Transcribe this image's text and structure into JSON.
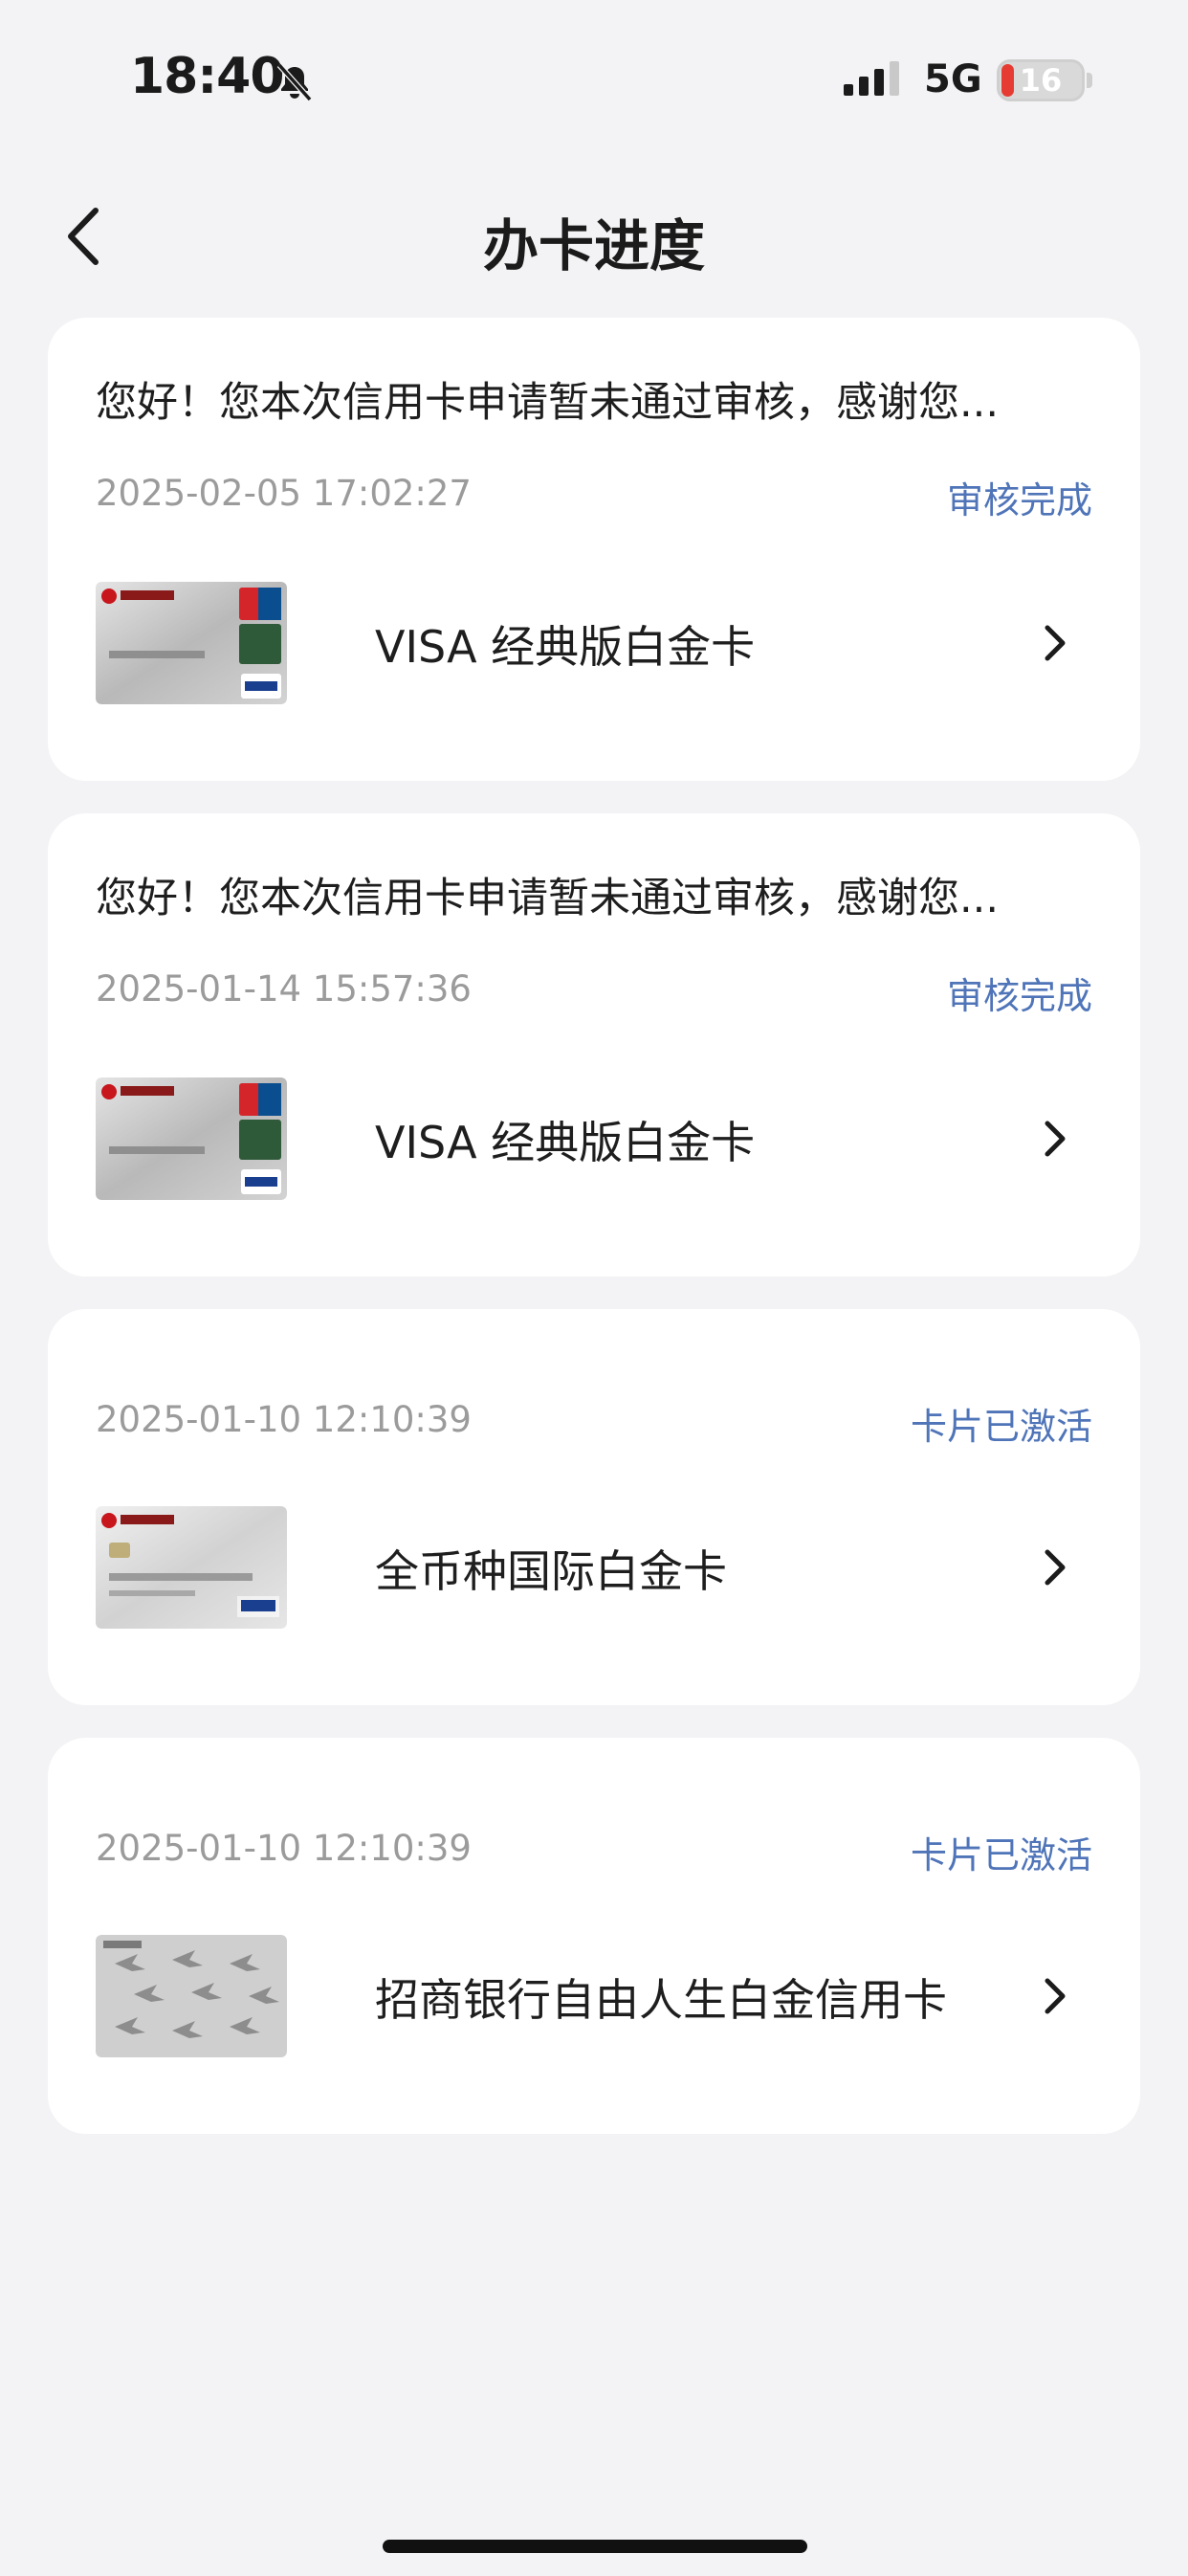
{
  "status_bar": {
    "time": "18:40",
    "network": "5G",
    "battery": "16",
    "battery_level": 0.16
  },
  "nav": {
    "title": "办卡进度"
  },
  "applications": [
    {
      "message": "您好！您本次信用卡申请暂未通过审核，感谢您...",
      "date": "2025-02-05 17:02:27",
      "status": "审核完成",
      "card_name": "VISA 经典版白金卡"
    },
    {
      "message": "您好！您本次信用卡申请暂未通过审核，感谢您...",
      "date": "2025-01-14 15:57:36",
      "status": "审核完成",
      "card_name": "VISA 经典版白金卡"
    },
    {
      "date": "2025-01-10 12:10:39",
      "status": "卡片已激活",
      "card_name": "全币种国际白金卡"
    },
    {
      "date": "2025-01-10 12:10:39",
      "status": "卡片已激活",
      "card_name": "招商银行自由人生白金信用卡"
    }
  ],
  "icons": {
    "back": "chevron-left-icon",
    "row": "chevron-right-icon",
    "status": [
      "bell-slash-icon",
      "signal-icon",
      "battery-icon"
    ]
  },
  "colors": {
    "accent": "#4f74b8",
    "background": "#f3f3f5",
    "card": "#ffffff",
    "muted": "#9b9b9b",
    "battery_low": "#e63b32"
  }
}
